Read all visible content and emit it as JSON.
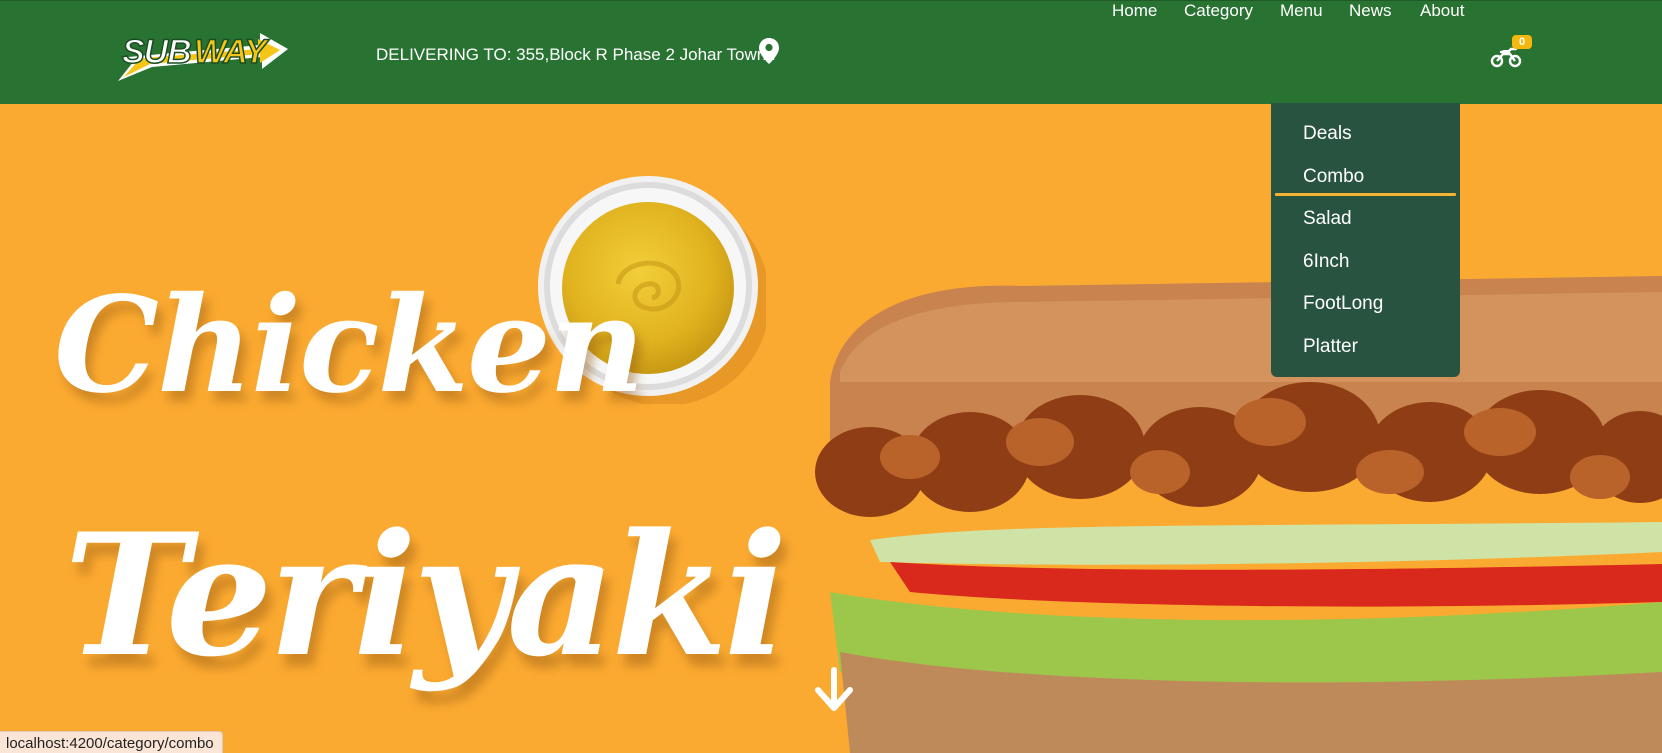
{
  "header": {
    "logo_text": "SUBWAY",
    "delivery_text": "DELIVERING TO: 355,Block R Phase 2 Johar Town..",
    "location_icon": "map-pin-icon",
    "nav": [
      {
        "label": "Home"
      },
      {
        "label": "Category"
      },
      {
        "label": "Menu"
      },
      {
        "label": "News"
      },
      {
        "label": "About"
      }
    ],
    "cart": {
      "icon": "motorcycle-icon",
      "count": "0"
    }
  },
  "menu_dropdown": {
    "items": [
      {
        "label": "Deals"
      },
      {
        "label": "Combo"
      },
      {
        "label": "Salad"
      },
      {
        "label": "6Inch"
      },
      {
        "label": "FootLong"
      },
      {
        "label": "Platter"
      }
    ],
    "hovered": "Combo"
  },
  "hero": {
    "title_line1": "Chicken",
    "title_line2": "Teriyaki",
    "scroll_icon": "arrow-down-icon"
  },
  "status_bar": {
    "url": "localhost:4200/category/combo"
  },
  "colors": {
    "header_green": "#287232",
    "dropdown_bg": "#275340",
    "hero_orange": "#fbaa31",
    "accent_yellow": "#f5b80f"
  }
}
